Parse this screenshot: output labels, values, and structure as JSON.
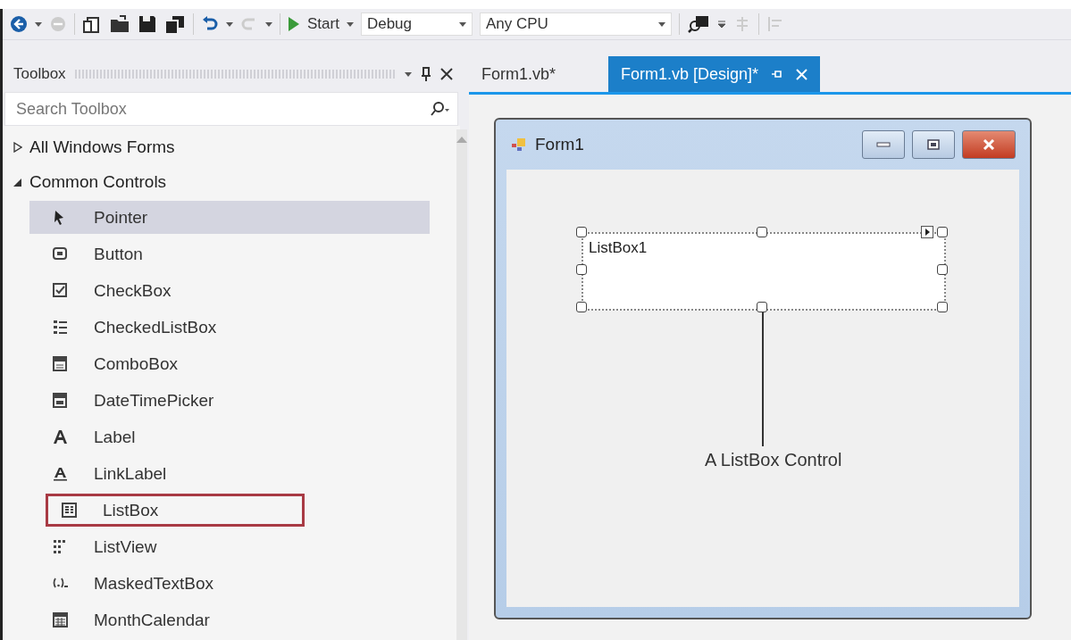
{
  "toolbar": {
    "start_label": "Start",
    "configuration": "Debug",
    "platform": "Any CPU"
  },
  "toolbox": {
    "title": "Toolbox",
    "search": {
      "placeholder": "Search Toolbox"
    },
    "groups": [
      {
        "label": "All Windows Forms",
        "expanded": false
      },
      {
        "label": "Common Controls",
        "expanded": true,
        "items": [
          {
            "label": "Pointer",
            "selected": true,
            "outlined": false
          },
          {
            "label": "Button",
            "selected": false,
            "outlined": false
          },
          {
            "label": "CheckBox",
            "selected": false,
            "outlined": false
          },
          {
            "label": "CheckedListBox",
            "selected": false,
            "outlined": false
          },
          {
            "label": "ComboBox",
            "selected": false,
            "outlined": false
          },
          {
            "label": "DateTimePicker",
            "selected": false,
            "outlined": false
          },
          {
            "label": "Label",
            "selected": false,
            "outlined": false
          },
          {
            "label": "LinkLabel",
            "selected": false,
            "outlined": false
          },
          {
            "label": "ListBox",
            "selected": false,
            "outlined": true
          },
          {
            "label": "ListView",
            "selected": false,
            "outlined": false
          },
          {
            "label": "MaskedTextBox",
            "selected": false,
            "outlined": false
          },
          {
            "label": "MonthCalendar",
            "selected": false,
            "outlined": false
          }
        ]
      }
    ]
  },
  "tabs": [
    {
      "label": "Form1.vb*",
      "selected": false
    },
    {
      "label": "Form1.vb [Design]*",
      "selected": true
    }
  ],
  "form": {
    "title": "Form1",
    "listbox": {
      "name": "ListBox1"
    },
    "annotation": "A ListBox Control"
  }
}
